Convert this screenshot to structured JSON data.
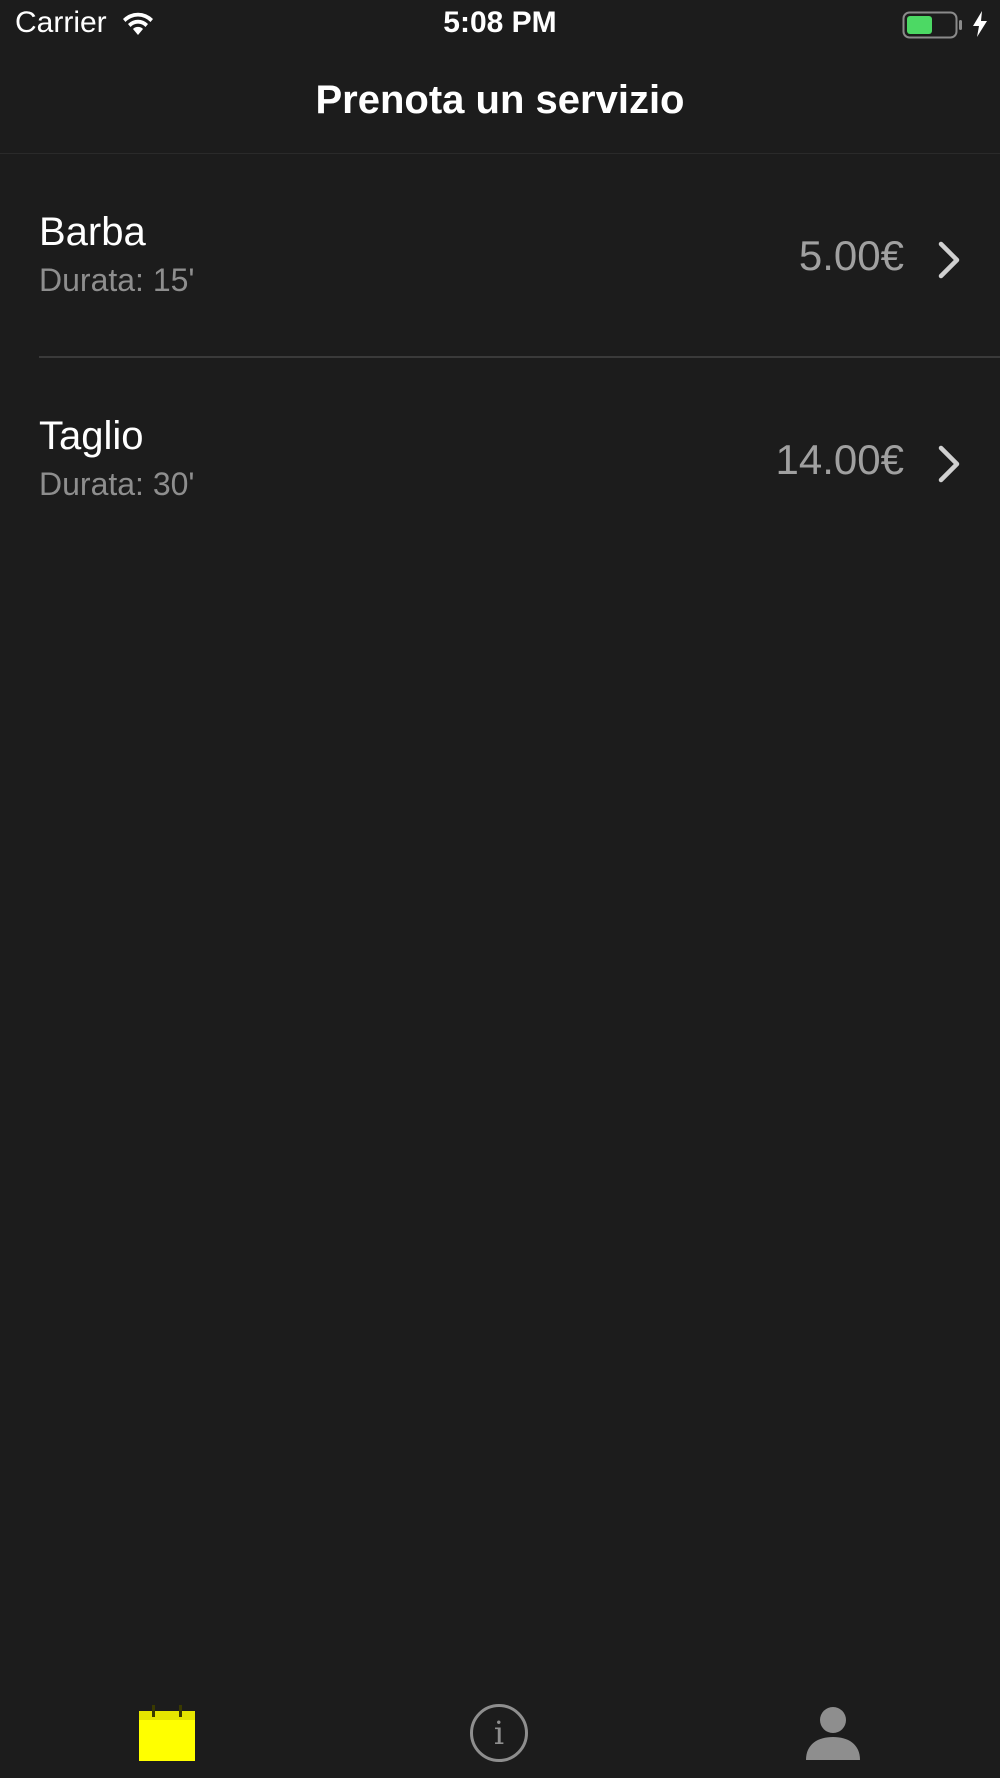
{
  "status_bar": {
    "carrier": "Carrier",
    "time": "5:08 PM",
    "wifi_icon": "wifi-icon",
    "battery_icon": "battery-icon",
    "charging_icon": "charging-bolt-icon",
    "battery_color": "#4cd964"
  },
  "nav": {
    "title": "Prenota un servizio"
  },
  "services": [
    {
      "name": "Barba",
      "duration": "Durata: 15'",
      "price": "5.00€"
    },
    {
      "name": "Taglio",
      "duration": "Durata: 30'",
      "price": "14.00€"
    }
  ],
  "tab_bar": {
    "tabs": [
      {
        "icon": "calendar-icon",
        "selected": true,
        "color": "#ffff00"
      },
      {
        "icon": "info-icon",
        "selected": false,
        "color": "#8e8e8e"
      },
      {
        "icon": "person-icon",
        "selected": false,
        "color": "#8e8e8e"
      }
    ]
  },
  "colors": {
    "background": "#1c1c1c",
    "accent": "#ffff00",
    "secondary_text": "#8e8e8e"
  }
}
